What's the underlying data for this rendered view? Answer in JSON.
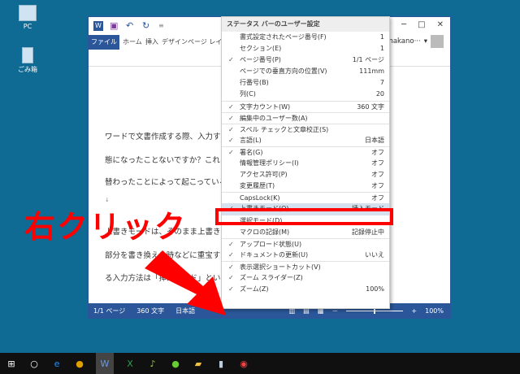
{
  "desktop": {
    "icons": [
      {
        "label": "PC"
      },
      {
        "label": "ごみ箱"
      }
    ]
  },
  "word": {
    "ribbon_tabs": [
      "ファイル",
      "ホーム",
      "挿入",
      "デザイン",
      "ページ レイ"
    ],
    "user": "nakano···",
    "doc_lines": [
      "ワードで文書作成する際、入力すると次",
      "態になったことないですか？これは、",
      "替わったことによって起こっている現",
      "↓",
      "上書きモードは、そのまま上書きしな",
      "部分を書き換える時などに重宝する入",
      "る入力方法は「挿入モード」といいま"
    ],
    "status": {
      "page": "1/1 ページ",
      "words": "360 文字",
      "lang": "日本語",
      "zoom": "100%",
      "minus": "－",
      "plus": "+"
    }
  },
  "menu": {
    "title": "ステータス バーのユーザー設定",
    "items": [
      {
        "label": "書式設定されたページ番号(F)",
        "value": "1",
        "checked": false
      },
      {
        "label": "セクション(E)",
        "value": "1",
        "checked": false
      },
      {
        "label": "ページ番号(P)",
        "value": "1/1 ページ",
        "checked": true
      },
      {
        "label": "ページでの垂直方向の位置(V)",
        "value": "111mm",
        "checked": false
      },
      {
        "label": "行番号(B)",
        "value": "7",
        "checked": false
      },
      {
        "label": "列(C)",
        "value": "20",
        "checked": false
      },
      {
        "label": "文字カウント(W)",
        "value": "360 文字",
        "checked": true,
        "sep": true
      },
      {
        "label": "編集中のユーザー数(A)",
        "value": "",
        "checked": true,
        "sep": true
      },
      {
        "label": "スペル チェックと文章校正(S)",
        "value": "",
        "checked": true,
        "sep": true
      },
      {
        "label": "言語(L)",
        "value": "日本語",
        "checked": true
      },
      {
        "label": "署名(G)",
        "value": "オフ",
        "checked": true,
        "sep": true
      },
      {
        "label": "情報管理ポリシー(I)",
        "value": "オフ",
        "checked": false
      },
      {
        "label": "アクセス許可(P)",
        "value": "オフ",
        "checked": false
      },
      {
        "label": "変更履歴(T)",
        "value": "オフ",
        "checked": false
      },
      {
        "label": "CapsLock(K)",
        "value": "オフ",
        "checked": false,
        "sep": true
      },
      {
        "label": "上書きモード(O)",
        "value": "挿入モード",
        "checked": true,
        "highlight": true
      },
      {
        "label": "選択モード(D)",
        "value": "",
        "checked": false
      },
      {
        "label": "マクロの記録(M)",
        "value": "記録停止中",
        "checked": false
      },
      {
        "label": "アップロード状態(U)",
        "value": "",
        "checked": true,
        "sep": true
      },
      {
        "label": "ドキュメントの更新(U)",
        "value": "いいえ",
        "checked": true
      },
      {
        "label": "表示選択ショートカット(V)",
        "value": "",
        "checked": true,
        "sep": true
      },
      {
        "label": "ズーム スライダー(Z)",
        "value": "",
        "checked": true
      },
      {
        "label": "ズーム(Z)",
        "value": "100%",
        "checked": true
      }
    ]
  },
  "annotation": {
    "text": "右クリック",
    "color": "#ff0000"
  },
  "check_glyph": "✓"
}
